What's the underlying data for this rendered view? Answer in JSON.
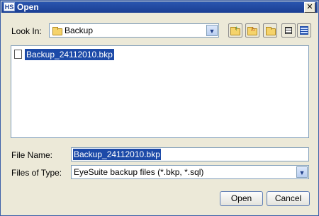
{
  "window": {
    "title": "Open",
    "app_icon": "HS",
    "close_glyph": "✕"
  },
  "look_in": {
    "label": "Look In:",
    "value": "Backup"
  },
  "toolbar": {
    "icons": [
      "up-folder-icon",
      "home-icon",
      "new-folder-icon",
      "list-view-icon",
      "details-view-icon"
    ]
  },
  "files": [
    {
      "name": "Backup_24112010.bkp",
      "selected": true
    }
  ],
  "file_name": {
    "label": "File Name:",
    "value": "Backup_24112010.bkp"
  },
  "file_type": {
    "label": "Files of Type:",
    "value": "EyeSuite backup files (*.bkp, *.sql)"
  },
  "buttons": {
    "open": "Open",
    "cancel": "Cancel"
  },
  "colors": {
    "title_bar": "#1b3f93",
    "selection": "#1c4aa8",
    "dialog_bg": "#ece9d8"
  }
}
